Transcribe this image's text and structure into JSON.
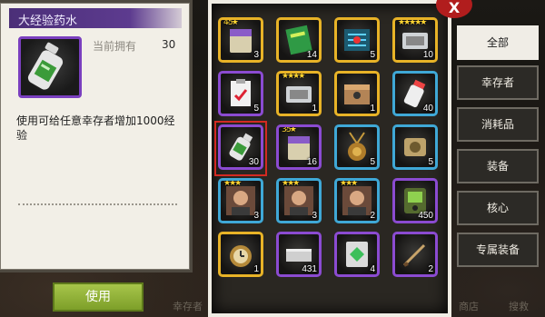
{
  "detail": {
    "title": "大经验药水",
    "owned_label": "当前拥有",
    "owned_value": "30",
    "description": "使用可给任意幸存者增加1000经验",
    "use_label": "使用"
  },
  "background": {
    "labels": [
      "幸存者",
      "商店",
      "搜救"
    ]
  },
  "close_label": "X",
  "categories": [
    {
      "label": "全部",
      "active": true
    },
    {
      "label": "幸存者",
      "active": false
    },
    {
      "label": "消耗品",
      "active": false
    },
    {
      "label": "装备",
      "active": false
    },
    {
      "label": "核心",
      "active": false
    },
    {
      "label": "专属装备",
      "active": false
    }
  ],
  "items": [
    {
      "name": "survivor-pack-4-5-star",
      "icon": "box-icon",
      "frame": "gold",
      "count": "3",
      "badge": "4-5★",
      "selected": false
    },
    {
      "name": "green-book",
      "icon": "book-icon",
      "frame": "gold",
      "count": "14",
      "badge": "",
      "selected": false
    },
    {
      "name": "circuit-chip",
      "icon": "chip-icon",
      "frame": "gold",
      "count": "5",
      "badge": "",
      "selected": false
    },
    {
      "name": "five-star-ticket",
      "icon": "ticket-icon",
      "frame": "gold",
      "count": "10",
      "badge": "★★★★★",
      "selected": false
    },
    {
      "name": "clipboard-report",
      "icon": "clipboard-icon",
      "frame": "purple",
      "count": "5",
      "badge": "",
      "selected": false
    },
    {
      "name": "four-star-ticket",
      "icon": "ticket-icon",
      "frame": "gold",
      "count": "1",
      "badge": "★★★★",
      "selected": false
    },
    {
      "name": "supply-crate",
      "icon": "crate-icon",
      "frame": "gold",
      "count": "1",
      "badge": "",
      "selected": false
    },
    {
      "name": "pill-bottle",
      "icon": "pill-bottle-icon",
      "frame": "blue",
      "count": "40",
      "badge": "",
      "selected": false
    },
    {
      "name": "large-exp-potion",
      "icon": "bottle-icon",
      "frame": "purple",
      "count": "30",
      "badge": "",
      "selected": true
    },
    {
      "name": "survivor-pack-3-5-star",
      "icon": "box-icon",
      "frame": "purple",
      "count": "16",
      "badge": "3-5★",
      "selected": false
    },
    {
      "name": "gold-medallion",
      "icon": "medallion-icon",
      "frame": "blue",
      "count": "5",
      "badge": "",
      "selected": false
    },
    {
      "name": "puzzle-cog",
      "icon": "cog-icon",
      "frame": "blue",
      "count": "5",
      "badge": "",
      "selected": false
    },
    {
      "name": "survivor-portrait-1",
      "icon": "portrait-icon",
      "frame": "blue",
      "count": "3",
      "badge": "★★★",
      "selected": false
    },
    {
      "name": "survivor-portrait-2",
      "icon": "portrait-icon",
      "frame": "blue",
      "count": "3",
      "badge": "★★★",
      "selected": false
    },
    {
      "name": "survivor-portrait-3",
      "icon": "portrait-icon",
      "frame": "blue",
      "count": "2",
      "badge": "★★★",
      "selected": false
    },
    {
      "name": "handheld-device",
      "icon": "device-icon",
      "frame": "purple",
      "count": "450",
      "badge": "",
      "selected": false
    },
    {
      "name": "pocket-watch",
      "icon": "watch-icon",
      "frame": "gold",
      "count": "1",
      "badge": "",
      "selected": false
    },
    {
      "name": "metal-plate",
      "icon": "plate-icon",
      "frame": "purple",
      "count": "431",
      "badge": "",
      "selected": false
    },
    {
      "name": "green-gem-card",
      "icon": "gem-card-icon",
      "frame": "purple",
      "count": "4",
      "badge": "",
      "selected": false
    },
    {
      "name": "knife",
      "icon": "knife-icon",
      "frame": "purple",
      "count": "2",
      "badge": "",
      "selected": false
    }
  ]
}
